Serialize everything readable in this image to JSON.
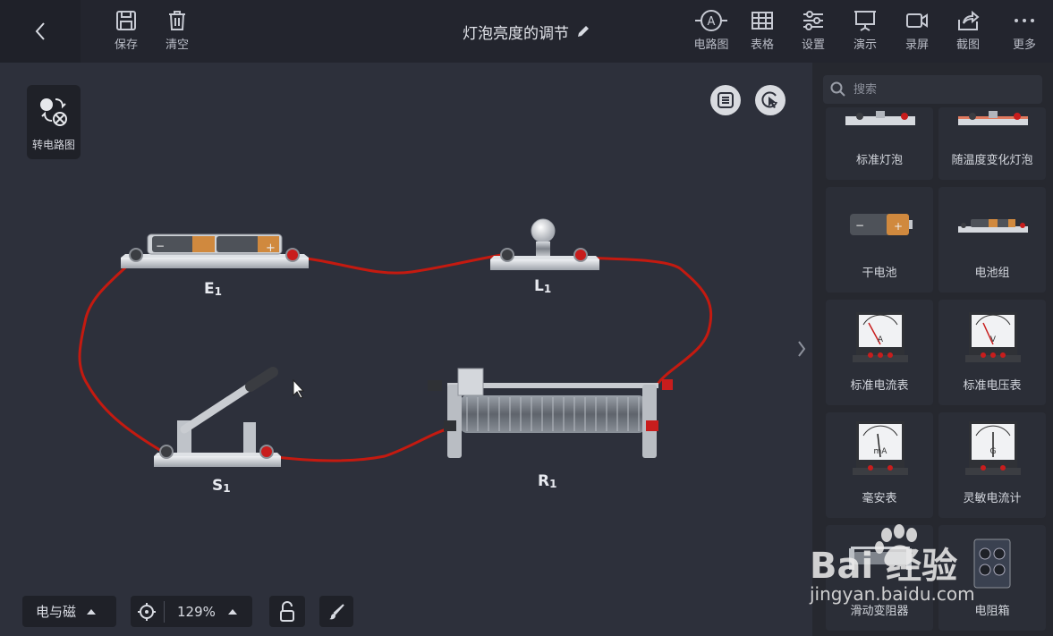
{
  "toolbar": {
    "save_label": "保存",
    "clear_label": "清空",
    "title": "灯泡亮度的调节",
    "circuit_label": "电路图",
    "table_label": "表格",
    "settings_label": "设置",
    "demo_label": "演示",
    "record_label": "录屏",
    "screenshot_label": "截图",
    "more_label": "更多"
  },
  "canvas": {
    "convert_label": "转电路图",
    "labels": [
      {
        "name": "E",
        "sub": "1"
      },
      {
        "name": "L",
        "sub": "1"
      },
      {
        "name": "S",
        "sub": "1"
      },
      {
        "name": "R",
        "sub": "1"
      }
    ],
    "wire_color": "#c41a10"
  },
  "bottom": {
    "category": "电与磁",
    "zoom": "129%"
  },
  "panel": {
    "search_placeholder": "搜索",
    "items": [
      {
        "label": "标准灯泡",
        "icon": "bulb-base-icon"
      },
      {
        "label": "随温度变化灯泡",
        "icon": "temp-bulb-icon"
      },
      {
        "label": "干电池",
        "icon": "battery-icon"
      },
      {
        "label": "电池组",
        "icon": "battery-pack-icon"
      },
      {
        "label": "标准电流表",
        "icon": "ammeter-icon"
      },
      {
        "label": "标准电压表",
        "icon": "voltmeter-icon"
      },
      {
        "label": "毫安表",
        "icon": "milliammeter-icon"
      },
      {
        "label": "灵敏电流计",
        "icon": "galvanometer-icon"
      },
      {
        "label": "滑动变阻器",
        "icon": "rheostat-icon"
      },
      {
        "label": "电阻箱",
        "icon": "resistance-box-icon"
      }
    ],
    "meter_letters": [
      "A",
      "V",
      "mA",
      "G"
    ]
  },
  "watermark": {
    "text": "jingyan.baidu.com",
    "logo": "Bai 经验"
  }
}
